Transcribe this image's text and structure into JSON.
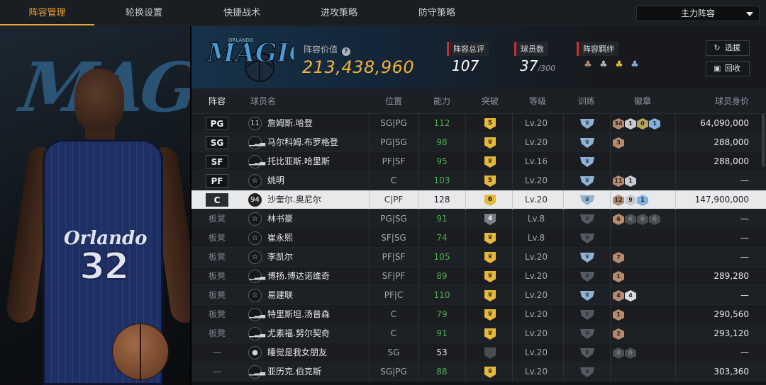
{
  "tabs": [
    "阵容管理",
    "轮换设置",
    "快捷战术",
    "进攻策略",
    "防守策略"
  ],
  "active_tab": 0,
  "lineup_select": {
    "value": "主力阵容"
  },
  "team": {
    "logo_text": "MAGIC",
    "logo_small": "ORLANDO",
    "value_label": "阵容价值",
    "value": "213,438,960",
    "rating_label": "阵容总评",
    "rating": "107",
    "players_label": "球员数",
    "players": "37",
    "players_max": "/300",
    "bond_label": "阵容羁绊",
    "bond_icons": [
      "bond-icon-1",
      "bond-icon-2",
      "bond-icon-3",
      "bond-icon-4"
    ]
  },
  "buttons": {
    "pick": "选拔",
    "recycle": "回收"
  },
  "portrait": {
    "team_script": "Orlando",
    "number": "32"
  },
  "columns": [
    "阵容",
    "球员名",
    "位置",
    "能力",
    "突破",
    "等级",
    "训练",
    "徽章",
    "球员身价"
  ],
  "players": [
    {
      "slot": "PG",
      "starter": true,
      "icon": "11",
      "name": "詹姆斯.哈登",
      "position": "SG|PG",
      "ability": "112",
      "break": "5",
      "break_style": "gold",
      "level": "Lv.20",
      "train": "blue",
      "medals": [
        [
          "34",
          "bronze"
        ],
        [
          "1",
          "silver"
        ],
        [
          "0",
          "gold"
        ],
        [
          "1",
          "blue"
        ]
      ],
      "worth": "64,090,000"
    },
    {
      "slot": "SG",
      "starter": true,
      "icon": "bars",
      "name": "马尔科姆.布罗格登",
      "position": "PG|SG",
      "ability": "98",
      "break": "crown",
      "break_style": "gold",
      "level": "Lv.20",
      "train": "blue",
      "medals": [
        [
          "3",
          "bronze"
        ]
      ],
      "worth": "288,000"
    },
    {
      "slot": "SF",
      "starter": true,
      "icon": "bars",
      "name": "托比亚斯.哈里斯",
      "position": "PF|SF",
      "ability": "95",
      "break": "crown",
      "break_style": "gold",
      "level": "Lv.16",
      "train": "blue",
      "medals": [],
      "worth": "288,000"
    },
    {
      "slot": "PF",
      "starter": true,
      "icon": "star",
      "name": "姚明",
      "position": "C",
      "ability": "103",
      "break": "5",
      "break_style": "gold",
      "level": "Lv.20",
      "train": "blue",
      "medals": [
        [
          "11",
          "bronze"
        ],
        [
          "1",
          "silver"
        ]
      ],
      "worth": "—"
    },
    {
      "slot": "C",
      "starter": true,
      "icon": "94",
      "name": "沙奎尔.奥尼尔",
      "position": "C|PF",
      "ability": "128",
      "break": "6",
      "break_style": "gold",
      "level": "Lv.20",
      "train": "blue",
      "medals": [
        [
          "12",
          "bronze"
        ],
        [
          "9",
          "silver"
        ],
        [
          "1",
          "blue"
        ]
      ],
      "worth": "147,900,000",
      "selected": true
    },
    {
      "slot": "板凳",
      "starter": false,
      "icon": "star",
      "name": "林书豪",
      "position": "PG|SG",
      "ability": "91",
      "break": "4",
      "break_style": "gray",
      "level": "Lv.8",
      "train": "gray",
      "medals": [
        [
          "6",
          "bronze"
        ],
        [
          "0",
          "dark"
        ],
        [
          "0",
          "dark"
        ],
        [
          "0",
          "dark"
        ]
      ],
      "worth": "—"
    },
    {
      "slot": "板凳",
      "starter": false,
      "icon": "star",
      "name": "崔永熙",
      "position": "SF|SG",
      "ability": "74",
      "break": "crown",
      "break_style": "gold",
      "level": "Lv.8",
      "train": "gray",
      "medals": [],
      "worth": "—"
    },
    {
      "slot": "板凳",
      "starter": false,
      "icon": "star",
      "name": "李凯尔",
      "position": "PF|SF",
      "ability": "105",
      "break": "crown",
      "break_style": "gold",
      "level": "Lv.20",
      "train": "blue",
      "medals": [
        [
          "7",
          "bronze"
        ]
      ],
      "worth": "—"
    },
    {
      "slot": "板凳",
      "starter": false,
      "icon": "bars",
      "name": "博扬.博达诺维奇",
      "position": "SF|PF",
      "ability": "89",
      "break": "crown",
      "break_style": "gold",
      "level": "Lv.20",
      "train": "gray",
      "medals": [
        [
          "1",
          "bronze"
        ]
      ],
      "worth": "289,280"
    },
    {
      "slot": "板凳",
      "starter": false,
      "icon": "star",
      "name": "易建联",
      "position": "PF|C",
      "ability": "110",
      "break": "crown",
      "break_style": "gold",
      "level": "Lv.20",
      "train": "blue",
      "medals": [
        [
          "4",
          "bronze"
        ],
        [
          "4",
          "sil2"
        ]
      ],
      "worth": "—"
    },
    {
      "slot": "板凳",
      "starter": false,
      "icon": "bars",
      "name": "特里斯坦.汤普森",
      "position": "C",
      "ability": "79",
      "break": "crown",
      "break_style": "gold",
      "level": "Lv.20",
      "train": "gray",
      "medals": [
        [
          "1",
          "bronze"
        ]
      ],
      "worth": "290,560"
    },
    {
      "slot": "板凳",
      "starter": false,
      "icon": "bars",
      "name": "尤素福.努尔契奇",
      "position": "C",
      "ability": "91",
      "break": "crown",
      "break_style": "gold",
      "level": "Lv.20",
      "train": "gray",
      "medals": [
        [
          "2",
          "bronze"
        ]
      ],
      "worth": "293,120"
    },
    {
      "slot": "—",
      "starter": false,
      "icon": "person",
      "name": "睡觉是我女朋友",
      "position": "SG",
      "ability": "53",
      "break": "",
      "break_style": "dark",
      "level": "Lv.20",
      "train": "gray",
      "medals": [
        [
          "0",
          "dark"
        ],
        [
          "0",
          "dark"
        ]
      ],
      "worth": "—"
    },
    {
      "slot": "—",
      "starter": false,
      "icon": "bars",
      "name": "亚历克.伯克斯",
      "position": "SG|PG",
      "ability": "88",
      "break": "crown",
      "break_style": "gold",
      "level": "Lv.20",
      "train": "gray",
      "medals": [],
      "worth": "303,360"
    }
  ]
}
